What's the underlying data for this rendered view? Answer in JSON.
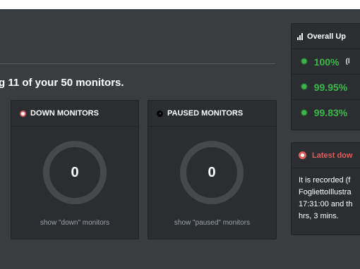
{
  "headline": "g 11 of your 50 monitors.",
  "down_panel": {
    "title": "DOWN MONITORS",
    "count": "0",
    "link": "show \"down\" monitors"
  },
  "paused_panel": {
    "title": "PAUSED MONITORS",
    "count": "0",
    "link": "show \"paused\" monitors"
  },
  "uptime": {
    "title": "Overall Up",
    "rows": [
      {
        "value": "100%",
        "note": "(l"
      },
      {
        "value": "99.95%",
        "note": ""
      },
      {
        "value": "99.83%",
        "note": ""
      }
    ]
  },
  "latest": {
    "title": "Latest dow",
    "lines": [
      "It is recorded (f",
      "FogliettoIllustra",
      "17:31:00 and th",
      "hrs, 3 mins."
    ]
  },
  "colors": {
    "up_green": "#3cb64a",
    "down_red": "#e25d5d",
    "panel_bg": "#2b2e31",
    "page_bg": "#3a3d40"
  }
}
